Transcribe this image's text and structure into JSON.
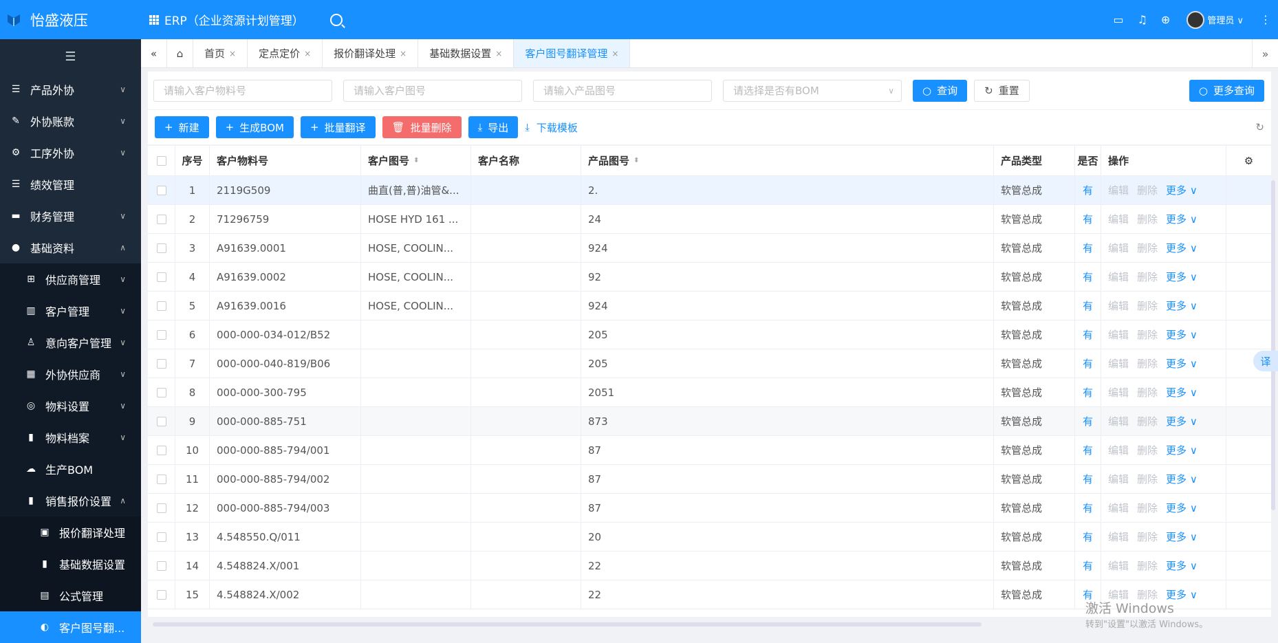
{
  "app": {
    "name": "怡盛液压",
    "system_title": "ERP（企业资源计划管理）",
    "user": "管理员"
  },
  "sidebar": {
    "items": [
      {
        "label": "产品外协",
        "icon": "list-icon",
        "level": 1,
        "arrow": "chevron-down-icon"
      },
      {
        "label": "外协账款",
        "icon": "edit-icon",
        "level": 1,
        "arrow": "chevron-down-icon"
      },
      {
        "label": "工序外协",
        "icon": "gear-icon",
        "level": 1,
        "arrow": "chevron-down-icon"
      },
      {
        "label": "绩效管理",
        "icon": "list-icon",
        "level": 1,
        "arrow": ""
      },
      {
        "label": "财务管理",
        "icon": "monitor-icon",
        "level": 1,
        "arrow": "chevron-down-icon"
      },
      {
        "label": "基础资料",
        "icon": "user-icon",
        "level": 1,
        "arrow": "chevron-up-icon"
      },
      {
        "label": "供应商管理",
        "icon": "plus-square-icon",
        "level": 2,
        "arrow": "chevron-down-icon"
      },
      {
        "label": "客户管理",
        "icon": "bar-chart-icon",
        "level": 2,
        "arrow": "chevron-down-icon"
      },
      {
        "label": "意向客户管理",
        "icon": "person-icon",
        "level": 2,
        "arrow": "chevron-down-icon"
      },
      {
        "label": "外协供应商",
        "icon": "grid-icon",
        "level": 2,
        "arrow": "chevron-down-icon"
      },
      {
        "label": "物料设置",
        "icon": "spiral-icon",
        "level": 2,
        "arrow": "chevron-down-icon"
      },
      {
        "label": "物料档案",
        "icon": "book-icon",
        "level": 2,
        "arrow": "chevron-down-icon"
      },
      {
        "label": "生产BOM",
        "icon": "cloud-upload-icon",
        "level": 2,
        "arrow": ""
      },
      {
        "label": "销售报价设置",
        "icon": "book-icon",
        "level": 2,
        "arrow": "chevron-up-icon"
      },
      {
        "label": "报价翻译处理",
        "icon": "device-icon",
        "level": 3,
        "arrow": ""
      },
      {
        "label": "基础数据设置",
        "icon": "book-icon",
        "level": 3,
        "arrow": ""
      },
      {
        "label": "公式管理",
        "icon": "doc-icon",
        "level": 3,
        "arrow": ""
      },
      {
        "label": "客户图号翻...",
        "icon": "palette-icon",
        "level": 3,
        "arrow": "",
        "active": true
      }
    ]
  },
  "tabs": [
    {
      "label": "首页",
      "closable": true
    },
    {
      "label": "定点定价",
      "closable": true
    },
    {
      "label": "报价翻译处理",
      "closable": true
    },
    {
      "label": "基础数据设置",
      "closable": true
    },
    {
      "label": "客户图号翻译管理",
      "closable": true,
      "active": true
    }
  ],
  "filters": {
    "customer_material_placeholder": "请输入客户物料号",
    "customer_drawing_placeholder": "请输入客户图号",
    "product_drawing_placeholder": "请输入产品图号",
    "bom_select_placeholder": "请选择是否有BOM",
    "query_label": "查询",
    "reset_label": "重置",
    "more_query_label": "更多查询"
  },
  "toolbar": {
    "new_label": "新建",
    "bom_label": "生成BOM",
    "batch_translate_label": "批量翻译",
    "batch_delete_label": "批量删除",
    "export_label": "导出",
    "download_template_label": "下载模板"
  },
  "table": {
    "headers": [
      "序号",
      "客户物料号",
      "客户图号",
      "客户名称",
      "产品图号",
      "产品类型",
      "是否",
      "操作"
    ],
    "op_labels": {
      "edit": "编辑",
      "delete": "删除",
      "more": "更多"
    },
    "rows": [
      {
        "no": "1",
        "material": "2119G509",
        "drawing": "曲直(普,普)油管&...",
        "name": "",
        "product": "2.",
        "type": "软管总成",
        "bom": "有"
      },
      {
        "no": "2",
        "material": "71296759",
        "drawing": "HOSE HYD 161 ...",
        "name": "",
        "product": "24",
        "type": "软管总成",
        "bom": "有"
      },
      {
        "no": "3",
        "material": "A91639.0001",
        "drawing": "HOSE, COOLIN...",
        "name": "",
        "product": "924",
        "type": "软管总成",
        "bom": "有"
      },
      {
        "no": "4",
        "material": "A91639.0002",
        "drawing": "HOSE, COOLIN...",
        "name": "",
        "product": "92",
        "type": "软管总成",
        "bom": "有"
      },
      {
        "no": "5",
        "material": "A91639.0016",
        "drawing": "HOSE, COOLIN...",
        "name": "",
        "product": "924",
        "type": "软管总成",
        "bom": "有"
      },
      {
        "no": "6",
        "material": "000-000-034-012/B52",
        "drawing": "",
        "name": "",
        "product": "205",
        "type": "软管总成",
        "bom": "有"
      },
      {
        "no": "7",
        "material": "000-000-040-819/B06",
        "drawing": "",
        "name": "",
        "product": "205",
        "type": "软管总成",
        "bom": "有"
      },
      {
        "no": "8",
        "material": "000-000-300-795",
        "drawing": "",
        "name": "",
        "product": "2051",
        "type": "软管总成",
        "bom": "有"
      },
      {
        "no": "9",
        "material": "000-000-885-751",
        "drawing": "",
        "name": "",
        "product": "873",
        "type": "软管总成",
        "bom": "有"
      },
      {
        "no": "10",
        "material": "000-000-885-794/001",
        "drawing": "",
        "name": "",
        "product": "87",
        "type": "软管总成",
        "bom": "有"
      },
      {
        "no": "11",
        "material": "000-000-885-794/002",
        "drawing": "",
        "name": "",
        "product": "87",
        "type": "软管总成",
        "bom": "有"
      },
      {
        "no": "12",
        "material": "000-000-885-794/003",
        "drawing": "",
        "name": "",
        "product": "87",
        "type": "软管总成",
        "bom": "有"
      },
      {
        "no": "13",
        "material": "4.548550.Q/011",
        "drawing": "",
        "name": "",
        "product": "20",
        "type": "软管总成",
        "bom": "有"
      },
      {
        "no": "14",
        "material": "4.548824.X/001",
        "drawing": "",
        "name": "",
        "product": "22",
        "type": "软管总成",
        "bom": "有"
      },
      {
        "no": "15",
        "material": "4.548824.X/002",
        "drawing": "",
        "name": "",
        "product": "22",
        "type": "软管总成",
        "bom": "有"
      }
    ]
  },
  "floating": {
    "translate_label": "译"
  },
  "watermark": {
    "line1": "激活 Windows",
    "line2": "转到\"设置\"以激活 Windows。"
  }
}
